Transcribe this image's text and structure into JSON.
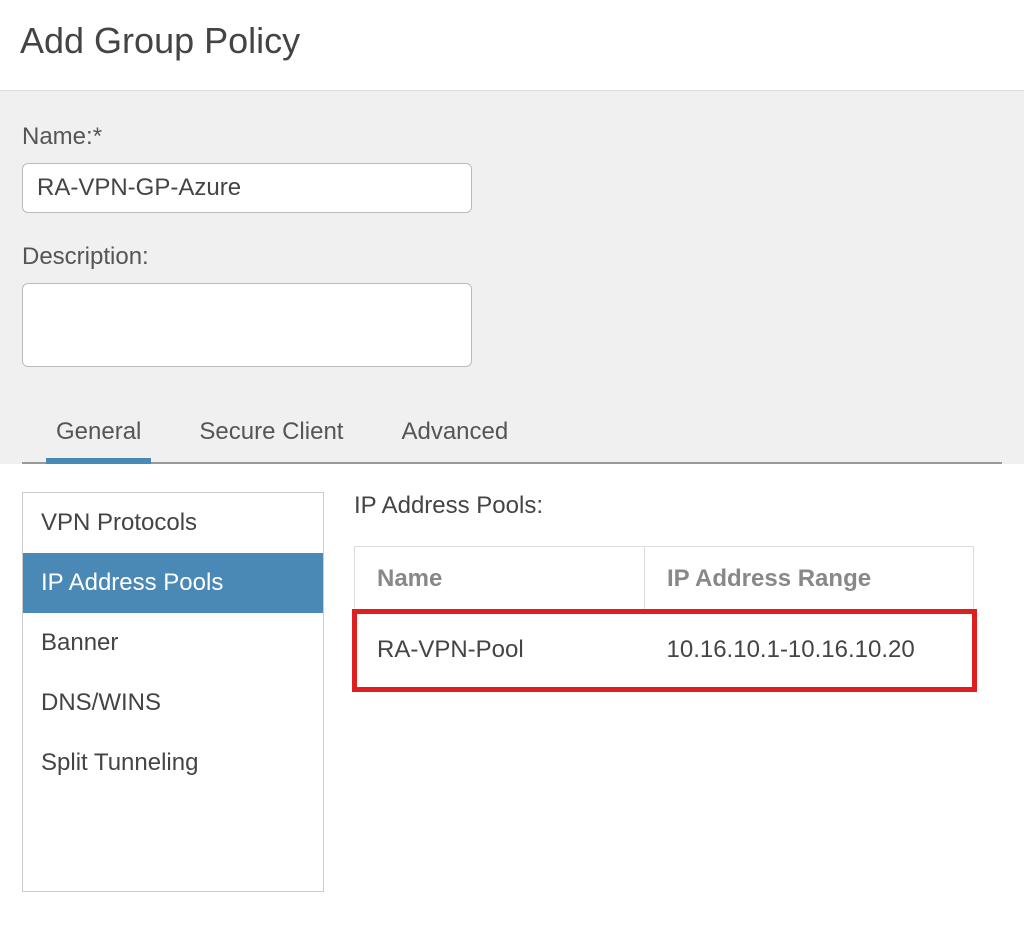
{
  "header": {
    "title": "Add Group Policy"
  },
  "form": {
    "name_label": "Name:*",
    "name_value": "RA-VPN-GP-Azure",
    "description_label": "Description:",
    "description_value": ""
  },
  "tabs": {
    "general": "General",
    "secure_client": "Secure Client",
    "advanced": "Advanced"
  },
  "sidenav": {
    "vpn_protocols": "VPN Protocols",
    "ip_address_pools": "IP Address Pools",
    "banner": "Banner",
    "dns_wins": "DNS/WINS",
    "split_tunneling": "Split Tunneling"
  },
  "pools": {
    "title": "IP Address Pools:",
    "columns": {
      "name": "Name",
      "range": "IP Address Range"
    },
    "rows": [
      {
        "name": "RA-VPN-Pool",
        "range": "10.16.10.1-10.16.10.20"
      }
    ]
  }
}
